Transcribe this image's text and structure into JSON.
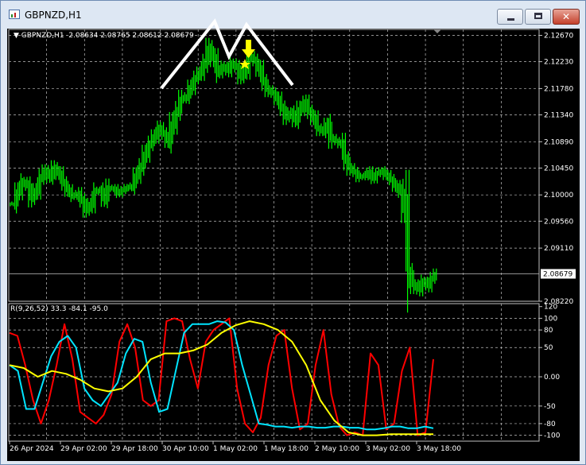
{
  "window": {
    "title": "GBPNZD,H1",
    "buttons": {
      "minimize": "minimize",
      "maximize": "maximize",
      "close": "✕"
    }
  },
  "chart_header": "▼ GBPNZD,H1  2.08634 2.08765 2.08612 2.08679",
  "price_axis_labels": [
    "2.12670",
    "2.12230",
    "2.11780",
    "2.11340",
    "2.10890",
    "2.10450",
    "2.10000",
    "2.09560",
    "2.09110",
    "2.08220"
  ],
  "current_price_label": "2.08679",
  "oscillator_header": "R(9,26,52) 33.3 -84.1 -95.0",
  "oscillator_axis_labels": [
    "120",
    "100",
    "80",
    "50",
    "0.00",
    "-50",
    "-80",
    "-100"
  ],
  "time_axis_labels": [
    "26 Apr 2024",
    "29 Apr 02:00",
    "29 Apr 18:00",
    "30 Apr 10:00",
    "1 May 02:00",
    "1 May 18:00",
    "2 May 10:00",
    "3 May 02:00",
    "3 May 18:00"
  ],
  "colors": {
    "background": "#000000",
    "grid": "#c0c0c0",
    "candles": "#00ff00",
    "osc_fast": "#ff0000",
    "osc_mid": "#00e5ff",
    "osc_slow": "#ffff00",
    "annotation_lines": "#ffffff",
    "arrow": "#ffff00"
  },
  "chart_data": [
    {
      "type": "candlestick",
      "ylim": [
        2.0822,
        2.1277
      ],
      "close": [
        2.0985,
        2.1005,
        2.1022,
        2.1015,
        2.0995,
        2.1008,
        2.1028,
        2.104,
        2.103,
        2.1045,
        2.1035,
        2.102,
        2.1008,
        2.0998,
        2.1002,
        2.099,
        2.0975,
        2.0985,
        2.1005,
        2.1008,
        2.0993,
        2.1012,
        2.101,
        2.1003,
        2.1008,
        2.1012,
        2.1015,
        2.1032,
        2.1048,
        2.1068,
        2.1085,
        2.1098,
        2.1112,
        2.1102,
        2.109,
        2.1118,
        2.114,
        2.116,
        2.1165,
        2.118,
        2.1195,
        2.1205,
        2.1222,
        2.1245,
        2.1228,
        2.1205,
        2.1215,
        2.1208,
        2.122,
        2.1213,
        2.1198,
        2.121,
        2.1232,
        2.1224,
        2.121,
        2.119,
        2.1176,
        2.117,
        2.116,
        2.1145,
        2.113,
        2.1138,
        2.1125,
        2.1143,
        2.1155,
        2.114,
        2.1128,
        2.1112,
        2.1106,
        2.1118,
        2.1095,
        2.109,
        2.1085,
        2.106,
        2.1045,
        2.1038,
        2.103,
        2.1032,
        2.1038,
        2.1028,
        2.1036,
        2.104,
        2.1033,
        2.1025,
        2.1015,
        2.1005,
        2.0975,
        2.087,
        2.085,
        2.0842,
        2.0855,
        2.0848,
        2.086,
        2.0868
      ]
    },
    {
      "type": "line",
      "ylim": [
        -110,
        125
      ],
      "series": [
        {
          "values": [
            75,
            70,
            20,
            -40,
            -80,
            -40,
            20,
            90,
            30,
            -60,
            -70,
            -80,
            -65,
            -30,
            60,
            90,
            50,
            -40,
            -50,
            -40,
            95,
            100,
            95,
            30,
            -20,
            60,
            80,
            90,
            100,
            -20,
            -80,
            -95,
            -70,
            20,
            70,
            80,
            -20,
            -90,
            -80,
            20,
            80,
            -30,
            -85,
            -100,
            -95,
            -100,
            40,
            20,
            -90,
            -80,
            10,
            50,
            -100,
            -95,
            30
          ]
        },
        {
          "values": [
            20,
            10,
            -55,
            -55,
            -10,
            35,
            60,
            70,
            50,
            -20,
            -40,
            -50,
            -30,
            -10,
            40,
            65,
            60,
            -10,
            -60,
            -55,
            10,
            75,
            90,
            90,
            90,
            95,
            93,
            80,
            20,
            -30,
            -80,
            -82,
            -85,
            -85,
            -87,
            -85,
            -85,
            -87,
            -87,
            -85,
            -85,
            -87,
            -87,
            -90,
            -90,
            -88,
            -85,
            -85,
            -88,
            -88,
            -85,
            -88
          ]
        },
        {
          "values": [
            20,
            15,
            0,
            10,
            5,
            -5,
            -20,
            -25,
            -20,
            0,
            30,
            40,
            40,
            45,
            55,
            75,
            88,
            95,
            90,
            80,
            60,
            20,
            -40,
            -75,
            -95,
            -100,
            -100,
            -98,
            -98,
            -98,
            -98
          ]
        }
      ]
    }
  ]
}
